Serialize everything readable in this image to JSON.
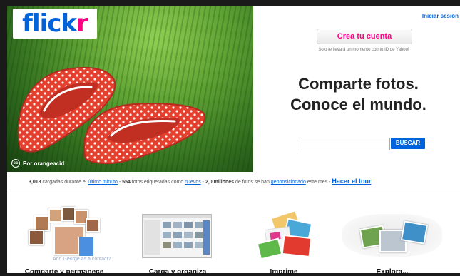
{
  "header": {
    "logo_text_a": "flick",
    "logo_text_b": "r",
    "signin": "Iniciar sesión",
    "create_account": "Crea tu cuenta",
    "create_note": "Solo te llevará un momento con tu ID de Yahoo!"
  },
  "hero": {
    "credit": "Por orangeacid",
    "credit_icon": "cc-icon",
    "tagline_1": "Comparte fotos.",
    "tagline_2": "Conoce el mundo."
  },
  "search": {
    "placeholder": "",
    "button": "BUSCAR"
  },
  "stats": {
    "uploaded_count": "3,018",
    "uploaded_text": " cargadas durante el ",
    "last_minute": "último minuto",
    "sep1": " - ",
    "tagged_count": "554",
    "tagged_text": " fotos etiquetadas como ",
    "new_link": "nuevos",
    "sep2": " - ",
    "geo_count": "2,0 millones",
    "geo_text": " de fotos se han ",
    "geo_link": "geoposicionado",
    "geo_tail": " este mes - ",
    "tour": "Hacer el tour"
  },
  "features": [
    {
      "label": "Comparte y permanece"
    },
    {
      "label": "Carga y organiza"
    },
    {
      "label": "Imprime"
    },
    {
      "label": "Explora..."
    }
  ],
  "feature1_overlay": "Add George as a contact?",
  "colors": {
    "flickr_blue": "#0063dc",
    "flickr_pink": "#ff0084"
  }
}
